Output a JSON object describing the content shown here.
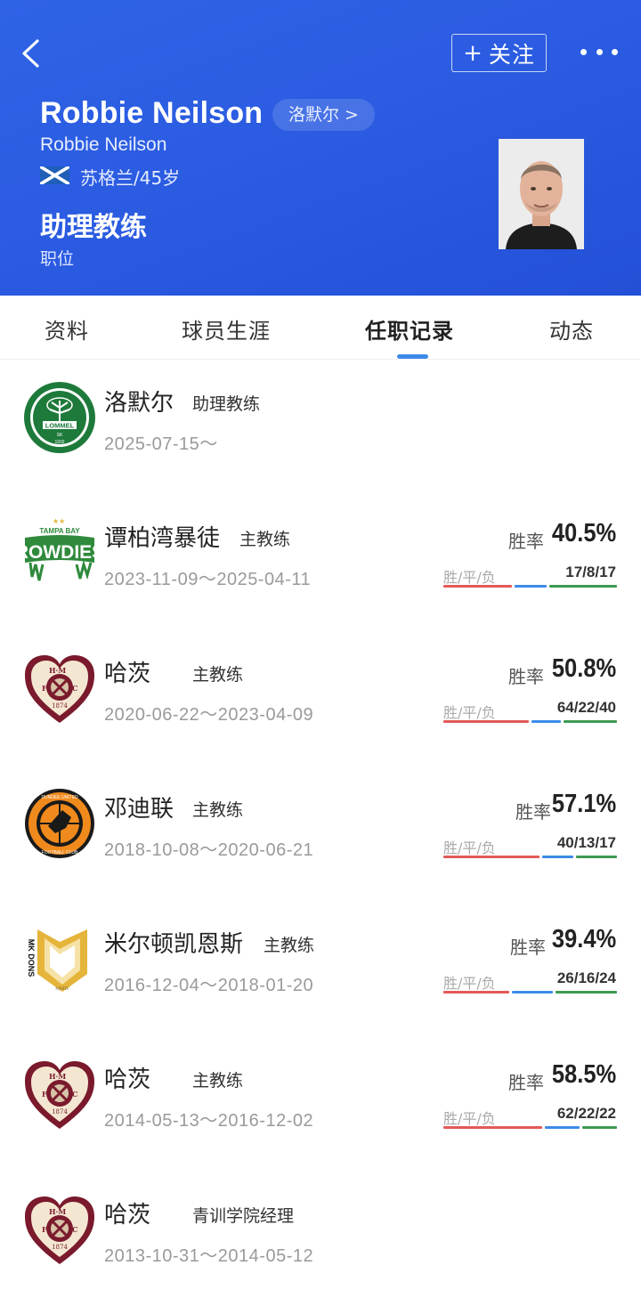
{
  "header": {
    "follow_label": "关注",
    "name": "Robbie Neilson",
    "current_team_chip": "洛默尔 >",
    "name_en": "Robbie Neilson",
    "nation_age": "苏格兰/45岁",
    "role": "助理教练",
    "role_caption": "职位",
    "colors": {
      "background": "#2a5ae0"
    }
  },
  "tabs": [
    {
      "label": "资料"
    },
    {
      "label": "球员生涯"
    },
    {
      "label": "任职记录",
      "active": true
    },
    {
      "label": "动态"
    }
  ],
  "colors": {
    "win": "#e25a58",
    "draw": "#3d8be9",
    "loss": "#3d9a52",
    "tab_indicator": "#3d8be9"
  },
  "records": [
    {
      "club": "洛默尔",
      "position": "助理教练",
      "dates": "2025-07-15～",
      "logo": "lommel-logo"
    },
    {
      "club": "谭柏湾暴徒",
      "position": "主教练",
      "dates": "2023-11-09～2025-04-11",
      "logo": "tampa-bay-rowdies-logo",
      "rate_label": "胜率",
      "rate": "40.5%",
      "wdl_label": "胜/平/负",
      "wdl": "17/8/17",
      "w": 17,
      "d": 8,
      "l": 17
    },
    {
      "club": "哈茨",
      "position": "主教练",
      "dates": "2020-06-22～2023-04-09",
      "logo": "hearts-logo",
      "rate_label": "胜率",
      "rate": "50.8%",
      "wdl_label": "胜/平/负",
      "wdl": "64/22/40",
      "w": 64,
      "d": 22,
      "l": 40
    },
    {
      "club": "邓迪联",
      "position": "主教练",
      "dates": "2018-10-08～2020-06-21",
      "logo": "dundee-united-logo",
      "rate_label": "胜率",
      "rate": "57.1%",
      "wdl_label": "胜/平/负",
      "wdl": "40/13/17",
      "w": 40,
      "d": 13,
      "l": 17
    },
    {
      "club": "米尔顿凯恩斯",
      "position": "主教练",
      "dates": "2016-12-04～2018-01-20",
      "logo": "mk-dons-logo",
      "rate_label": "胜率",
      "rate": "39.4%",
      "wdl_label": "胜/平/负",
      "wdl": "26/16/24",
      "w": 26,
      "d": 16,
      "l": 24
    },
    {
      "club": "哈茨",
      "position": "主教练",
      "dates": "2014-05-13～2016-12-02",
      "logo": "hearts-logo",
      "rate_label": "胜率",
      "rate": "58.5%",
      "wdl_label": "胜/平/负",
      "wdl": "62/22/22",
      "w": 62,
      "d": 22,
      "l": 22
    },
    {
      "club": "哈茨",
      "position": "青训学院经理",
      "dates": "2013-10-31～2014-05-12",
      "logo": "hearts-logo"
    }
  ]
}
